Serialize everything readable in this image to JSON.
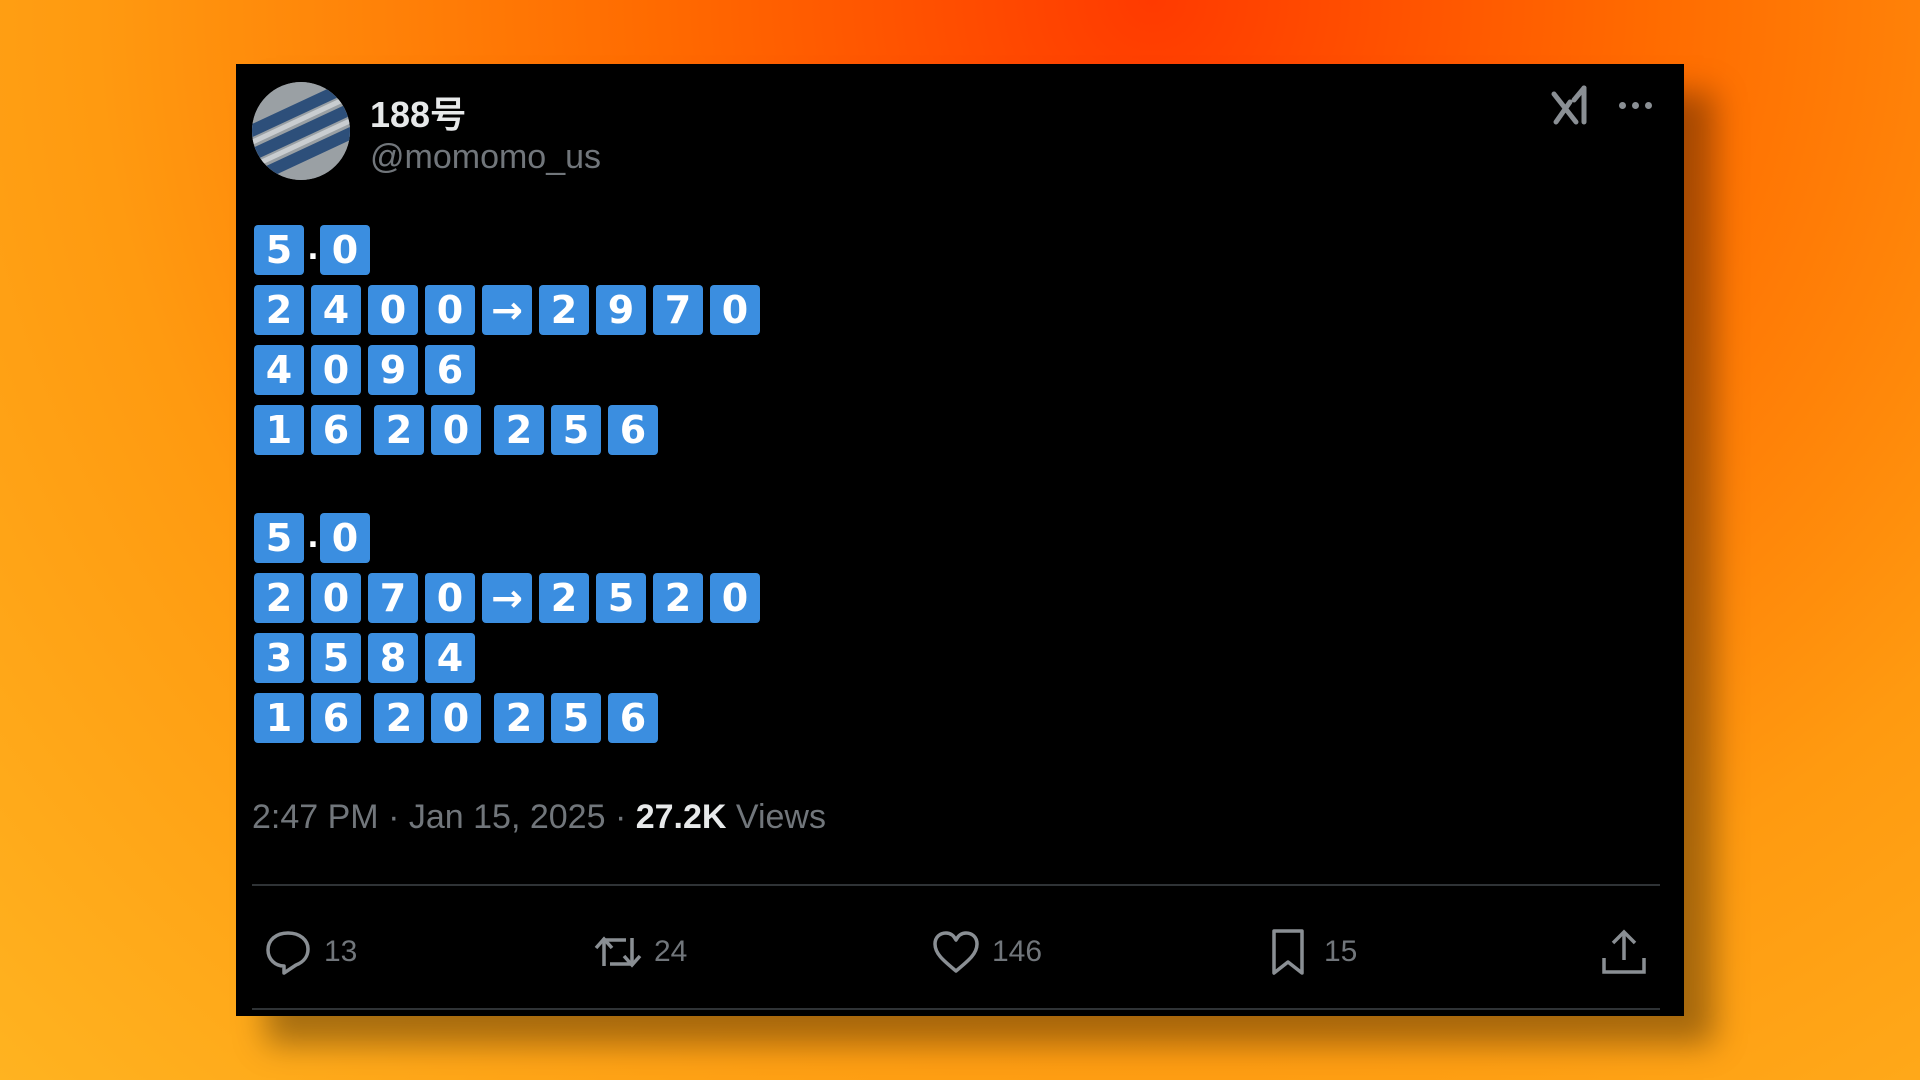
{
  "author": {
    "display_name": "188号",
    "handle": "@momomo_us"
  },
  "icons": {
    "grok": "grok-icon",
    "more": "more-options-icon",
    "reply": "reply-icon",
    "repost": "repost-icon",
    "like": "heart-icon",
    "bookmark": "bookmark-icon",
    "share": "share-icon"
  },
  "post": {
    "line1": [
      "5",
      ".",
      "0"
    ],
    "line2": [
      "2",
      "4",
      "0",
      "0",
      "→",
      "2",
      "9",
      "7",
      "0"
    ],
    "line3": [
      "4",
      "0",
      "9",
      "6"
    ],
    "line4": [
      "1",
      "6",
      " ",
      "2",
      "0",
      " ",
      "2",
      "5",
      "6"
    ],
    "line5": [
      "5",
      ".",
      "0"
    ],
    "line6": [
      "2",
      "0",
      "7",
      "0",
      "→",
      "2",
      "5",
      "2",
      "0"
    ],
    "line7": [
      "3",
      "5",
      "8",
      "4"
    ],
    "line8": [
      "1",
      "6",
      " ",
      "2",
      "0",
      " ",
      "2",
      "5",
      "6"
    ]
  },
  "meta": {
    "time": "2:47 PM",
    "separator": "·",
    "date": "Jan 15, 2025",
    "views_count": "27.2K",
    "views_label": "Views"
  },
  "actions": {
    "replies": "13",
    "reposts": "24",
    "likes": "146",
    "bookmarks": "15"
  },
  "colors": {
    "keycap": "#3b8ee0",
    "card_bg": "#000000",
    "muted_text": "#71767b"
  }
}
